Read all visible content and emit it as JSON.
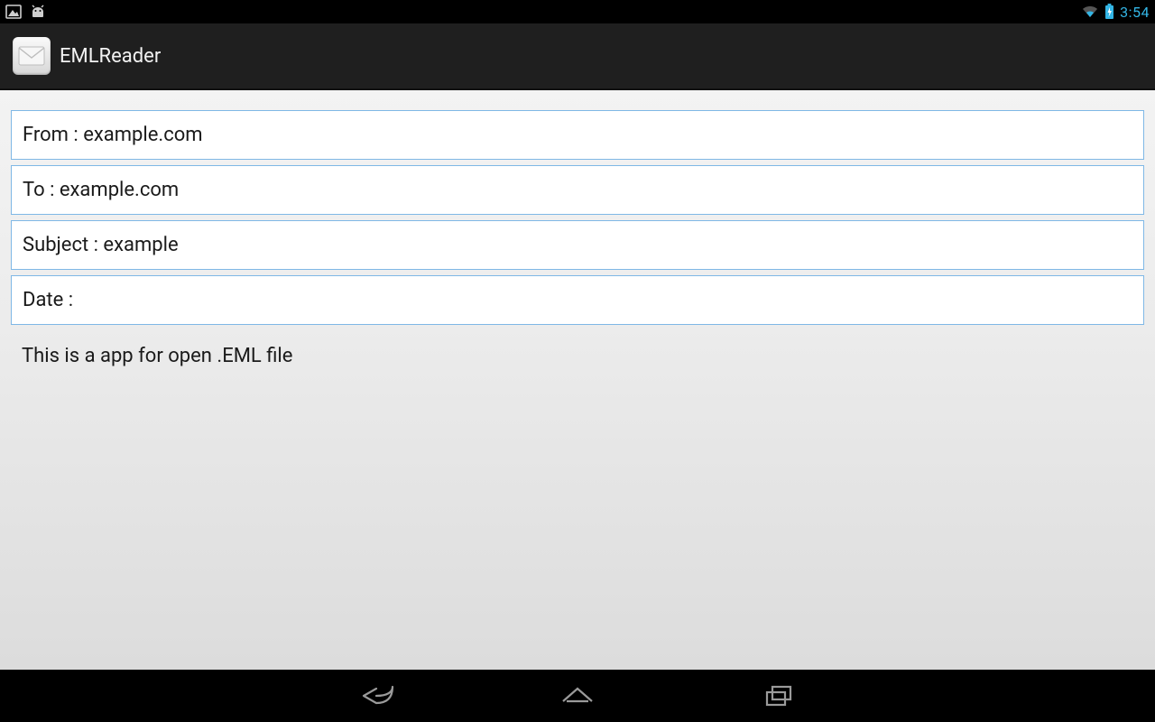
{
  "status": {
    "clock": "3:54"
  },
  "app": {
    "title": "EMLReader"
  },
  "email": {
    "from": "From : example.com",
    "to": "To : example.com",
    "subject": "Subject : example",
    "date": "Date :",
    "body": "This is a app for open .EML file"
  }
}
